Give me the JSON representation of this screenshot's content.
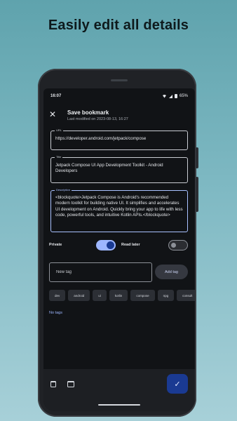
{
  "headline": "Easily edit all details",
  "status_bar": {
    "time": "16:07",
    "battery": "65%"
  },
  "top_bar": {
    "close_icon": "close-icon",
    "title": "Save bookmark",
    "subtitle": "Last modified on 2023-08-13, 16:27"
  },
  "fields": {
    "url": {
      "label": "URL",
      "value": "https://developer.android.com/jetpack/compose"
    },
    "title": {
      "label": "Title",
      "value": "Jetpack Compose UI App Development Toolkit - Android Developers"
    },
    "description": {
      "label": "Description",
      "value": "<blockquote>Jetpack Compose is Android's recommended modern toolkit for building native UI. It simplifies and accelerates UI development on Android. Quickly bring your app to life with less code, powerful tools, and intuitive Kotlin APIs.</blockquote>"
    }
  },
  "toggles": {
    "private": {
      "label": "Private",
      "state": "on"
    },
    "read_later": {
      "label": "Read later",
      "state": "off"
    }
  },
  "tags": {
    "new_tag_placeholder": "New tag",
    "add_button": "Add tag",
    "suggestions": [
      "dev",
      "android",
      "ui",
      "kotlin",
      "compose",
      "npg",
      "consult"
    ],
    "empty_text": "No tags"
  },
  "bottom_bar": {
    "icons": [
      "delete-icon",
      "open-browser-icon"
    ],
    "fab_icon": "check-icon"
  },
  "colors": {
    "accent": "#9db6ff",
    "fab": "#1a3a92",
    "screen_bg": "#111316"
  }
}
